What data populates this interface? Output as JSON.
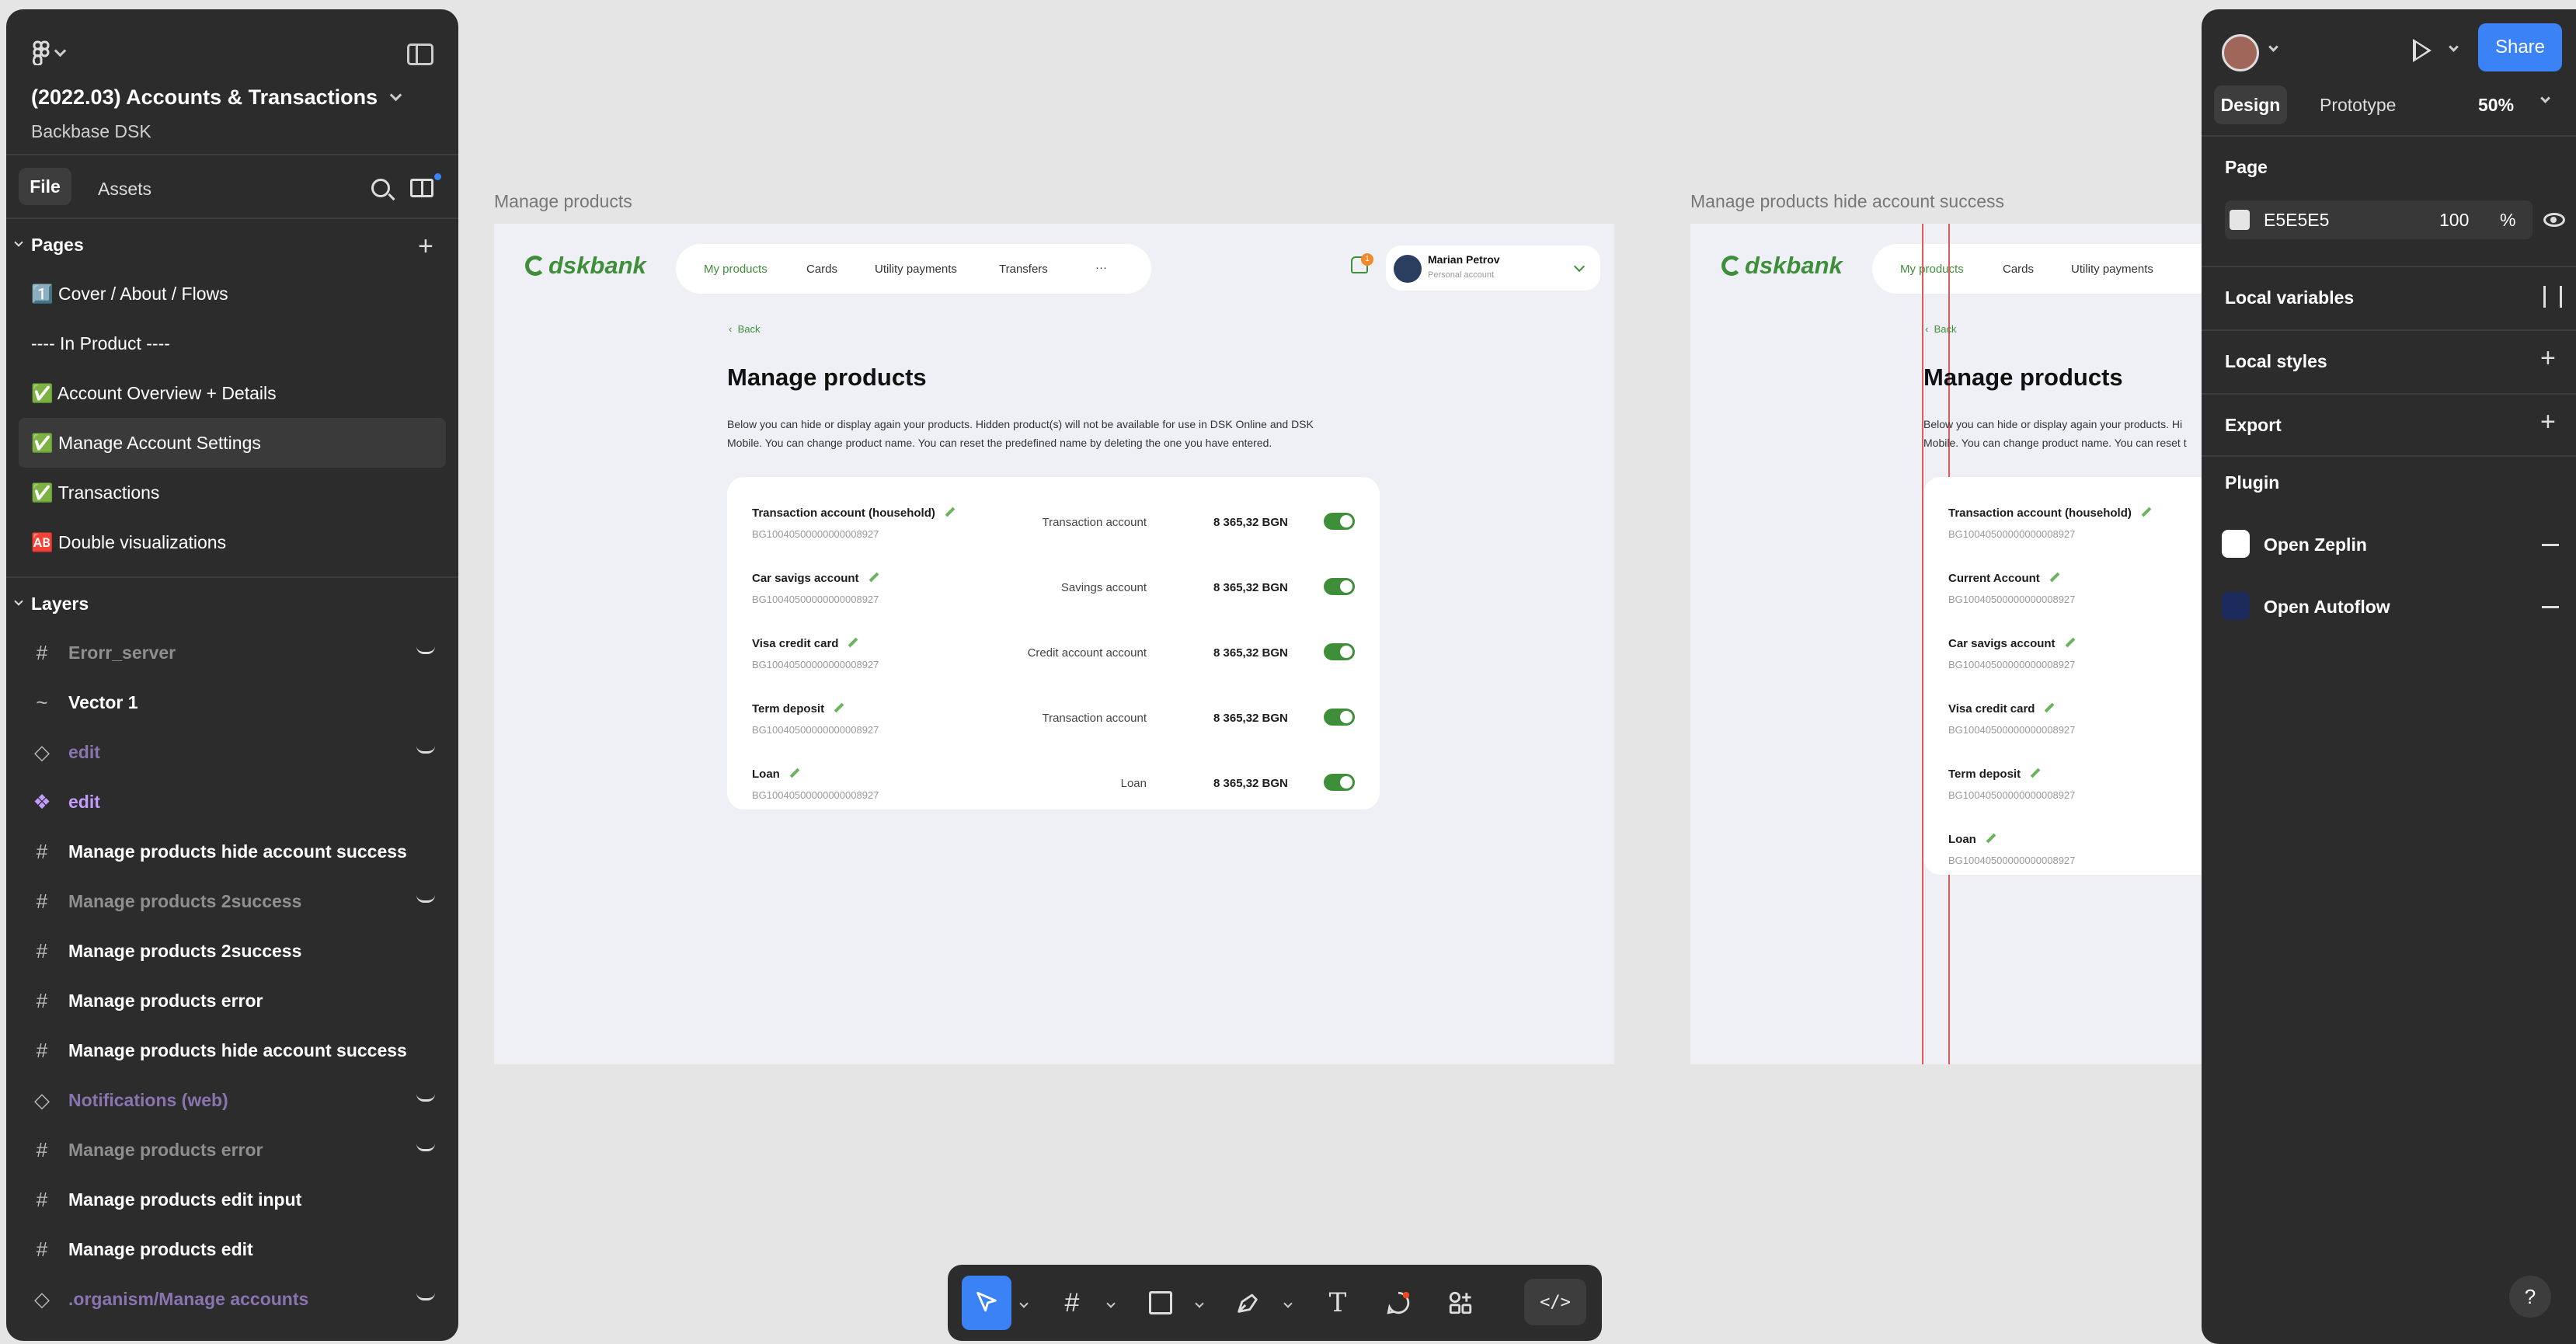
{
  "file": {
    "title": "(2022.03) Accounts & Transactions",
    "team": "Backbase DSK"
  },
  "left_tabs": {
    "file": "File",
    "assets": "Assets"
  },
  "pages": {
    "heading": "Pages",
    "items": [
      {
        "label": "1️⃣ Cover / About / Flows"
      },
      {
        "label": "----  In Product ----"
      },
      {
        "label": "✅ Account Overview + Details"
      },
      {
        "label": "✅ Manage Account Settings"
      },
      {
        "label": "✅ Transactions"
      },
      {
        "label": "🆎 Double visualizations"
      }
    ]
  },
  "layers": {
    "heading": "Layers",
    "items": [
      {
        "label": "Erorr_server",
        "icon": "frame-icon"
      },
      {
        "label": "Vector 1",
        "icon": "vector-icon"
      },
      {
        "label": "edit",
        "icon": "instance-icon"
      },
      {
        "label": "edit",
        "icon": "component-icon"
      },
      {
        "label": "Manage products hide account success",
        "icon": "frame-icon"
      },
      {
        "label": "Manage products 2success",
        "icon": "frame-icon"
      },
      {
        "label": "Manage products 2success",
        "icon": "frame-icon"
      },
      {
        "label": "Manage products error",
        "icon": "frame-icon"
      },
      {
        "label": "Manage products hide account success",
        "icon": "frame-icon"
      },
      {
        "label": "Notifications (web)",
        "icon": "instance-icon"
      },
      {
        "label": "Manage products error",
        "icon": "frame-icon"
      },
      {
        "label": "Manage products edit input",
        "icon": "frame-icon"
      },
      {
        "label": "Manage products edit",
        "icon": "frame-icon"
      },
      {
        "label": ".organism/Manage accounts",
        "icon": "instance-icon"
      }
    ]
  },
  "canvas": {
    "frame1_label": "Manage products",
    "frame2_label": "Manage products hide account success",
    "bank": {
      "brand": "dskbank",
      "nav": [
        "My products",
        "Cards",
        "Utility payments",
        "Transfers",
        "···"
      ],
      "notif_count": "1",
      "user_name": "Marian Petrov",
      "user_sub": "Personal account",
      "back": "Back",
      "title": "Manage products",
      "desc1": "Below you can hide or display again your products. Hidden product(s) will not be available for use in DSK Online and DSK",
      "desc2": "Mobile. You can change product name. You can reset the predefined name by deleting the one you have entered.",
      "rows": [
        {
          "name": "Transaction account (household)",
          "iban": "BG10040500000000008927",
          "type": "Transaction account",
          "amount": "8 365,32 BGN"
        },
        {
          "name": "Car savigs account",
          "iban": "BG10040500000000008927",
          "type": "Savings account",
          "amount": "8 365,32 BGN"
        },
        {
          "name": "Visa credit card",
          "iban": "BG10040500000000008927",
          "type": "Credit account account",
          "amount": "8 365,32 BGN"
        },
        {
          "name": "Term deposit",
          "iban": "BG10040500000000008927",
          "type": "Transaction account",
          "amount": "8 365,32 BGN"
        },
        {
          "name": "Loan",
          "iban": "BG10040500000000008927",
          "type": "Loan",
          "amount": "8 365,32 BGN"
        }
      ],
      "desc2_short": "Below you can hide or display again your products. Hi",
      "desc2b_short": "Mobile. You can change product name. You can reset t",
      "rows2": [
        {
          "name": "Transaction account (household)",
          "iban": "BG10040500000000008927"
        },
        {
          "name": "Current Account",
          "iban": "BG10040500000000008927"
        },
        {
          "name": "Car savigs account",
          "iban": "BG10040500000000008927"
        },
        {
          "name": "Visa credit card",
          "iban": "BG10040500000000008927"
        },
        {
          "name": "Term deposit",
          "iban": "BG10040500000000008927"
        },
        {
          "name": "Loan",
          "iban": "BG10040500000000008927"
        }
      ]
    }
  },
  "right": {
    "share": "Share",
    "tabs": {
      "design": "Design",
      "prototype": "Prototype"
    },
    "zoom": "50%",
    "page_heading": "Page",
    "page_color": "E5E5E5",
    "page_opacity": "100",
    "page_opacity_unit": "%",
    "local_variables": "Local variables",
    "local_styles": "Local styles",
    "export": "Export",
    "plugin_heading": "Plugin",
    "plugins": [
      {
        "label": "Open Zeplin"
      },
      {
        "label": "Open Autoflow"
      }
    ],
    "help": "?"
  },
  "toolbar": {
    "dev_mode": "</>"
  },
  "colors": {
    "brand_green": "#3f8f3a",
    "accent_blue": "#3b82f6",
    "panel": "#2c2c2c",
    "canvas": "#e5e5e5"
  }
}
